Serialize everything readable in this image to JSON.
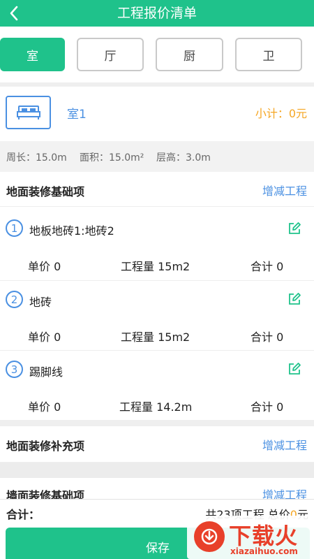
{
  "header": {
    "title": "工程报价清单"
  },
  "tabs": [
    {
      "label": "室",
      "active": true
    },
    {
      "label": "厅",
      "active": false
    },
    {
      "label": "厨",
      "active": false
    },
    {
      "label": "卫",
      "active": false
    }
  ],
  "room": {
    "name": "室1",
    "subtotal": "小计：0元"
  },
  "dimensions": {
    "perimeter": "周长：15.0m",
    "area": "面积：15.0m²",
    "height": "层高：3.0m"
  },
  "sections": [
    {
      "title": "地面装修基础项",
      "action": "增减工程",
      "items": [
        {
          "index": "1",
          "name": "地板地砖1:地砖2",
          "price": "单价 0",
          "qty": "工程量 15m2",
          "total": "合计 0"
        },
        {
          "index": "2",
          "name": "地砖",
          "price": "单价 0",
          "qty": "工程量 15m2",
          "total": "合计 0"
        },
        {
          "index": "3",
          "name": "踢脚线",
          "price": "单价 0",
          "qty": "工程量 14.2m",
          "total": "合计 0"
        }
      ]
    },
    {
      "title": "地面装修补充项",
      "action": "增减工程"
    },
    {
      "title": "墙面装修基础项",
      "action": "增减工程"
    }
  ],
  "footer": {
    "total_label": "合计：",
    "summary_prefix": "共23项工程  总价",
    "summary_amount": "0",
    "summary_unit": "元",
    "save_label": "保存"
  },
  "watermark": {
    "brand": "下载火",
    "domain": "xiazaihuo.com"
  },
  "colors": {
    "primary": "#1fc28b",
    "link": "#4a90e2",
    "accent": "#f5a623",
    "watermark": "#e8402a"
  }
}
